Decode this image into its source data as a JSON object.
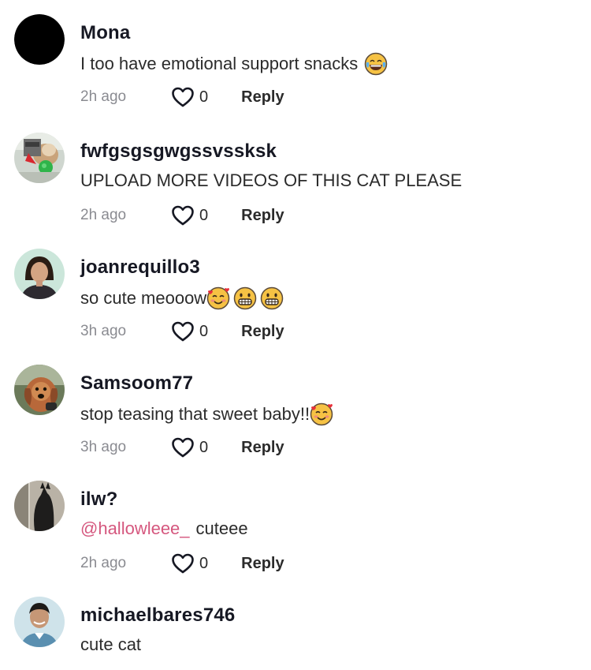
{
  "comments": [
    {
      "username": "Mona",
      "mention": "",
      "text": "I too have emotional support snacks",
      "emojis": [
        "joy-emoji"
      ],
      "time": "2h ago",
      "likes": "0",
      "reply_label": "Reply",
      "avatar": "black-circle-avatar"
    },
    {
      "username": "fwfgsgsgwgssvssksk",
      "mention": "",
      "text": "UPLOAD MORE VIDEOS OF THIS CAT PLEASE",
      "emojis": [],
      "time": "2h ago",
      "likes": "0",
      "reply_label": "Reply",
      "avatar": "cat-photo-avatar"
    },
    {
      "username": "joanrequillo3",
      "mention": "",
      "text": "so cute meooow",
      "emojis": [
        "smiling-hearts-emoji",
        "grin-emoji",
        "grin-emoji"
      ],
      "time": "3h ago",
      "likes": "0",
      "reply_label": "Reply",
      "avatar": "woman-photo-avatar"
    },
    {
      "username": "Samsoom77",
      "mention": "",
      "text": "stop teasing that sweet baby!!",
      "emojis": [
        "smiling-hearts-emoji"
      ],
      "time": "3h ago",
      "likes": "0",
      "reply_label": "Reply",
      "avatar": "dog-photo-avatar"
    },
    {
      "username": "ilw?",
      "mention": "@hallowleee_",
      "text": "cuteee",
      "emojis": [],
      "time": "2h ago",
      "likes": "0",
      "reply_label": "Reply",
      "avatar": "dark-cat-photo-avatar"
    },
    {
      "username": "michaelbares746",
      "mention": "",
      "text": "cute cat",
      "emojis": [],
      "time": "",
      "likes": "",
      "reply_label": "",
      "avatar": "man-photo-avatar"
    }
  ],
  "colors": {
    "username": "#161823",
    "text": "#2b2b2b",
    "time": "#8a8b91",
    "mention": "#d5577e"
  },
  "icons": {
    "like": "heart-outline-icon"
  }
}
